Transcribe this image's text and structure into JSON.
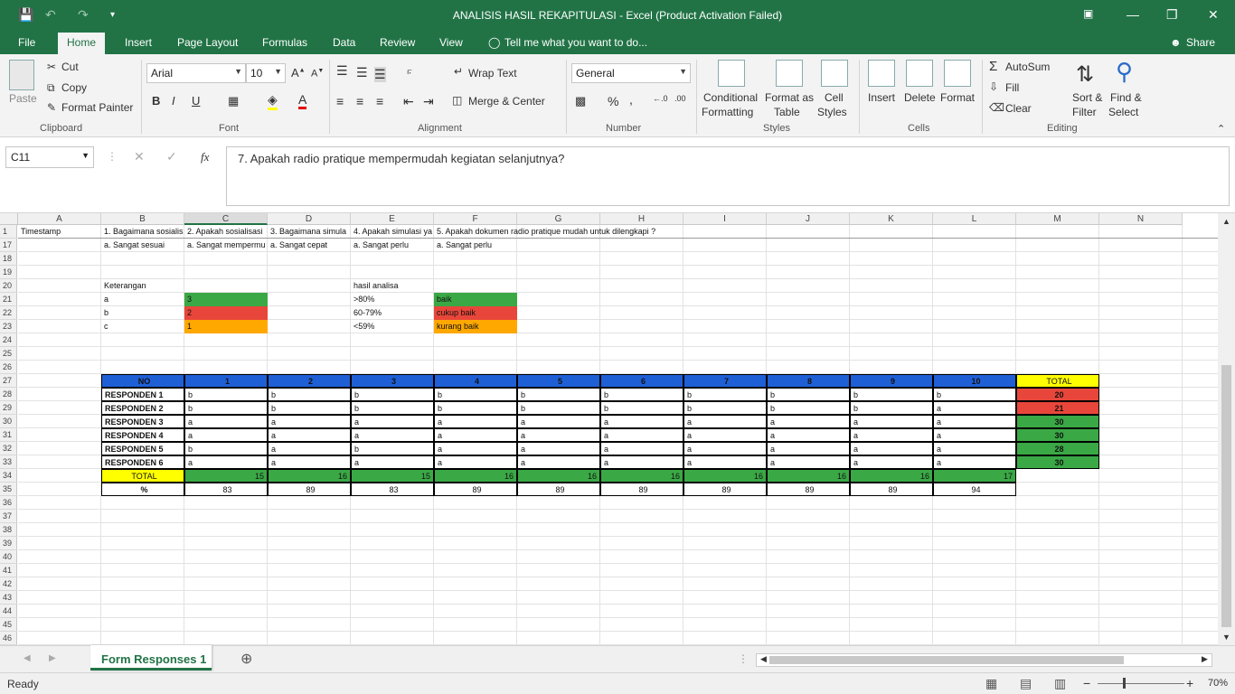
{
  "window": {
    "title": "ANALISIS HASIL REKAPITULASI - Excel (Product Activation Failed)",
    "share": "Share"
  },
  "tabs": [
    "File",
    "Home",
    "Insert",
    "Page Layout",
    "Formulas",
    "Data",
    "Review",
    "View"
  ],
  "tell_me": "Tell me what you want to do...",
  "ribbon": {
    "clipboard": {
      "paste": "Paste",
      "cut": "Cut",
      "copy": "Copy",
      "format_painter": "Format Painter",
      "label": "Clipboard"
    },
    "font": {
      "name": "Arial",
      "size": "10",
      "label": "Font",
      "bold": "B",
      "italic": "I",
      "underline": "U"
    },
    "alignment": {
      "wrap": "Wrap Text",
      "merge": "Merge & Center",
      "label": "Alignment"
    },
    "number": {
      "format": "General",
      "label": "Number",
      "percent": "%",
      "comma": ","
    },
    "styles": {
      "cond1": "Conditional",
      "cond2": "Formatting",
      "fat1": "Format as",
      "fat2": "Table",
      "cs1": "Cell",
      "cs2": "Styles",
      "label": "Styles"
    },
    "cells": {
      "insert": "Insert",
      "delete": "Delete",
      "format": "Format",
      "label": "Cells"
    },
    "editing": {
      "autosum": "AutoSum",
      "fill": "Fill",
      "clear": "Clear",
      "sort1": "Sort &",
      "sort2": "Filter",
      "find1": "Find &",
      "find2": "Select",
      "label": "Editing"
    }
  },
  "formula_bar": {
    "name_box": "C11",
    "fx": "fx",
    "content": "7.  Apakah radio pratique mempermudah kegiatan selanjutnya?"
  },
  "columns": [
    "A",
    "B",
    "C",
    "D",
    "E",
    "F",
    "G",
    "H",
    "I",
    "J",
    "K",
    "L",
    "M",
    "N"
  ],
  "rows": [
    "1",
    "17",
    "18",
    "19",
    "20",
    "21",
    "22",
    "23",
    "24",
    "25",
    "26",
    "27",
    "28",
    "29",
    "30",
    "31",
    "32",
    "33",
    "34",
    "35",
    "36",
    "37",
    "38",
    "39",
    "40",
    "41",
    "42",
    "43",
    "44",
    "45",
    "46"
  ],
  "row1": {
    "A": "Timestamp",
    "B": "1. Bagaimana sosialis",
    "C": "2. Apakah sosialisasi",
    "D": "3. Bagaimana simula",
    "E": "4. Apakah simulasi ya",
    "F": "5. Apakah dokumen radio pratique mudah untuk dilengkapi ?"
  },
  "row17": {
    "B": "a. Sangat sesuai",
    "C": "a. Sangat mempermu",
    "D": "a. Sangat cepat",
    "E": "a. Sangat perlu",
    "F": "a. Sangat perlu"
  },
  "legend": {
    "keterangan": "Keterangan",
    "hasil": "hasil analisa",
    "items": [
      {
        "code": "a",
        "score": "3",
        "range": ">80%",
        "result": "baik",
        "color": "#3aa845"
      },
      {
        "code": "b",
        "score": "2",
        "range": "60-79%",
        "result": "cukup baik",
        "color": "#e8463a"
      },
      {
        "code": "c",
        "score": "1",
        "range": "<59%",
        "result": "kurang baik",
        "color": "#ffa800"
      }
    ]
  },
  "table": {
    "header": [
      "NO",
      "1",
      "2",
      "3",
      "4",
      "5",
      "6",
      "7",
      "8",
      "9",
      "10",
      "TOTAL"
    ],
    "rows": [
      {
        "name": "RESPONDEN 1",
        "answers": [
          "b",
          "b",
          "b",
          "b",
          "b",
          "b",
          "b",
          "b",
          "b",
          "b"
        ],
        "total": "20",
        "color": "#e8463a"
      },
      {
        "name": "RESPONDEN 2",
        "answers": [
          "b",
          "b",
          "b",
          "b",
          "b",
          "b",
          "b",
          "b",
          "b",
          "a"
        ],
        "total": "21",
        "color": "#e8463a"
      },
      {
        "name": "RESPONDEN 3",
        "answers": [
          "a",
          "a",
          "a",
          "a",
          "a",
          "a",
          "a",
          "a",
          "a",
          "a"
        ],
        "total": "30",
        "color": "#3aa845"
      },
      {
        "name": "RESPONDEN 4",
        "answers": [
          "a",
          "a",
          "a",
          "a",
          "a",
          "a",
          "a",
          "a",
          "a",
          "a"
        ],
        "total": "30",
        "color": "#3aa845"
      },
      {
        "name": "RESPONDEN 5",
        "answers": [
          "b",
          "a",
          "b",
          "a",
          "a",
          "a",
          "a",
          "a",
          "a",
          "a"
        ],
        "total": "28",
        "color": "#3aa845"
      },
      {
        "name": "RESPONDEN 6",
        "answers": [
          "a",
          "a",
          "a",
          "a",
          "a",
          "a",
          "a",
          "a",
          "a",
          "a"
        ],
        "total": "30",
        "color": "#3aa845"
      }
    ],
    "total_label": "TOTAL",
    "totals": [
      "15",
      "16",
      "15",
      "16",
      "16",
      "16",
      "16",
      "16",
      "16",
      "17"
    ],
    "percent_label": "%",
    "percents": [
      "83",
      "89",
      "83",
      "89",
      "89",
      "89",
      "89",
      "89",
      "89",
      "94"
    ]
  },
  "colors": {
    "excel_green": "#217346",
    "header_blue": "#1f5fd6",
    "total_yellow": "#ffff00"
  },
  "sheet_tab": "Form Responses 1",
  "status": {
    "ready": "Ready",
    "zoom": "70%"
  }
}
